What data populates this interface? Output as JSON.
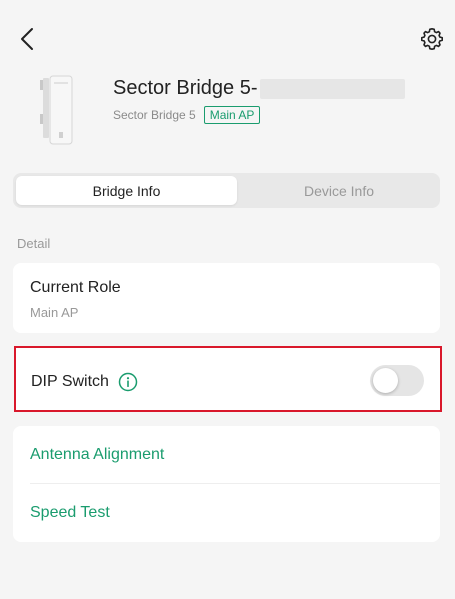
{
  "header": {
    "back_icon": "chevron-left-icon",
    "settings_icon": "gear-icon"
  },
  "device": {
    "title": "Sector Bridge 5-",
    "model": "Sector Bridge 5",
    "role_badge": "Main AP"
  },
  "tabs": [
    {
      "label": "Bridge Info",
      "active": true
    },
    {
      "label": "Device Info",
      "active": false
    }
  ],
  "detail": {
    "section_label": "Detail",
    "current_role_title": "Current Role",
    "current_role_value": "Main AP"
  },
  "dip_switch": {
    "label": "DIP Switch",
    "info_icon": "info-circle-icon",
    "enabled": false
  },
  "links": [
    {
      "label": "Antenna Alignment"
    },
    {
      "label": "Speed Test"
    }
  ],
  "colors": {
    "accent": "#1a9c6e",
    "highlight": "#d9182b",
    "background": "#f5f5f5"
  }
}
